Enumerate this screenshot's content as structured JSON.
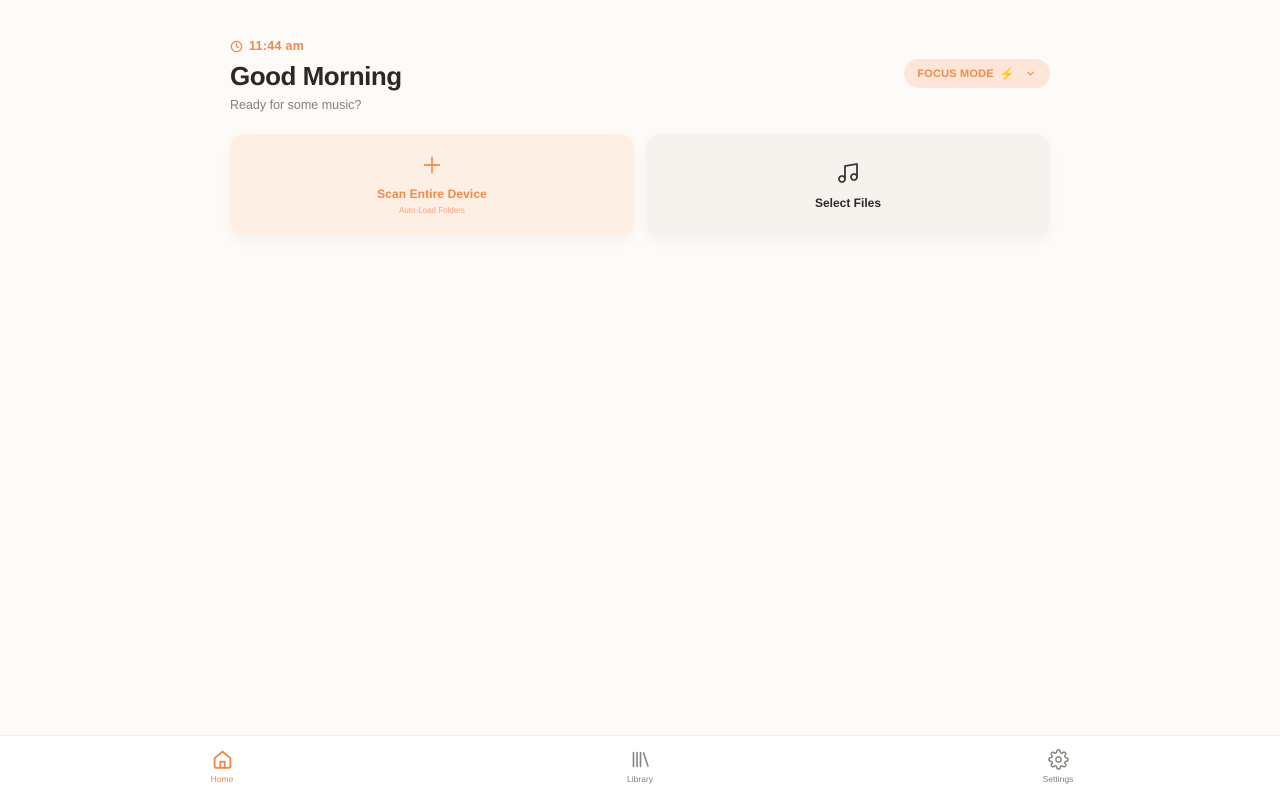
{
  "header": {
    "time": "11:44 am",
    "greeting": "Good Morning",
    "subtitle": "Ready for some music?",
    "focus_mode_label": "FOCUS MODE",
    "focus_mode_emoji": "⚡"
  },
  "cards": {
    "scan": {
      "title": "Scan Entire Device",
      "subtitle": "Auto-Load Folders",
      "icon": "plus-icon"
    },
    "files": {
      "title": "Select Files",
      "icon": "music-note-icon"
    }
  },
  "nav": {
    "items": [
      {
        "label": "Home",
        "icon": "home-icon",
        "active": true
      },
      {
        "label": "Library",
        "icon": "library-icon",
        "active": false
      },
      {
        "label": "Settings",
        "icon": "gear-icon",
        "active": false
      }
    ]
  },
  "colors": {
    "accent": "#ef8a4c",
    "background": "#fdfbf8",
    "text": "#2b2926",
    "muted": "#85817c"
  }
}
